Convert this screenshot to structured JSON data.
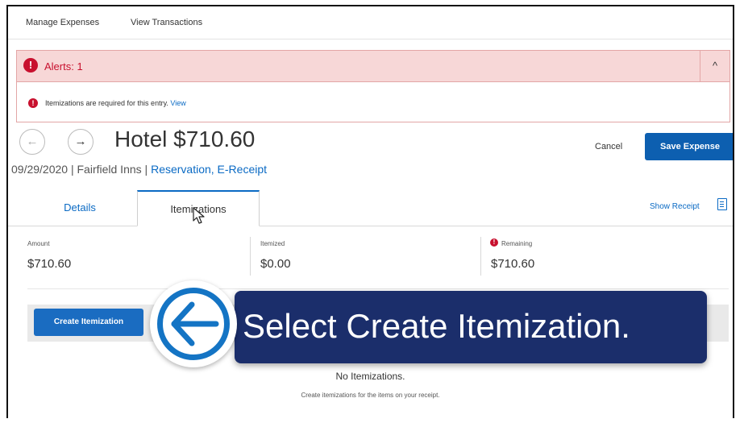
{
  "topnav": {
    "items": [
      "Manage Expenses",
      "View Transactions"
    ]
  },
  "alerts": {
    "title": "Alerts: 1",
    "message": "Itemizations are required for this entry.",
    "message_link": "View"
  },
  "expense": {
    "title": "Hotel $710.60",
    "date": "09/29/2020",
    "vendor": "Fairfield Inns",
    "receipt_types": "Reservation, E-Receipt",
    "separator": "|"
  },
  "actions": {
    "cancel": "Cancel",
    "save": "Save Expense"
  },
  "tabs": {
    "details": "Details",
    "itemizations": "Itemizations"
  },
  "show_receipt": "Show Receipt",
  "summary": {
    "amount_label": "Amount",
    "amount_value": "$710.60",
    "itemized_label": "Itemized",
    "itemized_value": "$0.00",
    "remaining_label": "Remaining",
    "remaining_value": "$710.60"
  },
  "create_button": "Create Itemization",
  "empty_state": {
    "title": "No Itemizations.",
    "subtitle": "Create itemizations for the items on your receipt."
  },
  "overlay": {
    "instruction": "Select Create Itemization."
  },
  "icons": {
    "alert": "alert-icon",
    "collapse": "chevron-up-icon",
    "back": "arrow-left-icon",
    "forward": "arrow-right-icon",
    "receipt": "receipt-icon",
    "pointer": "arrow-left-icon",
    "cursor": "mouse-cursor-icon"
  },
  "colors": {
    "accent": "#0d5fb0",
    "link": "#0a6ac4",
    "alert": "#c8102e",
    "alert_bg": "#f7d7d7",
    "banner": "#1b2e6b",
    "pointer_ring": "#1474c4"
  }
}
